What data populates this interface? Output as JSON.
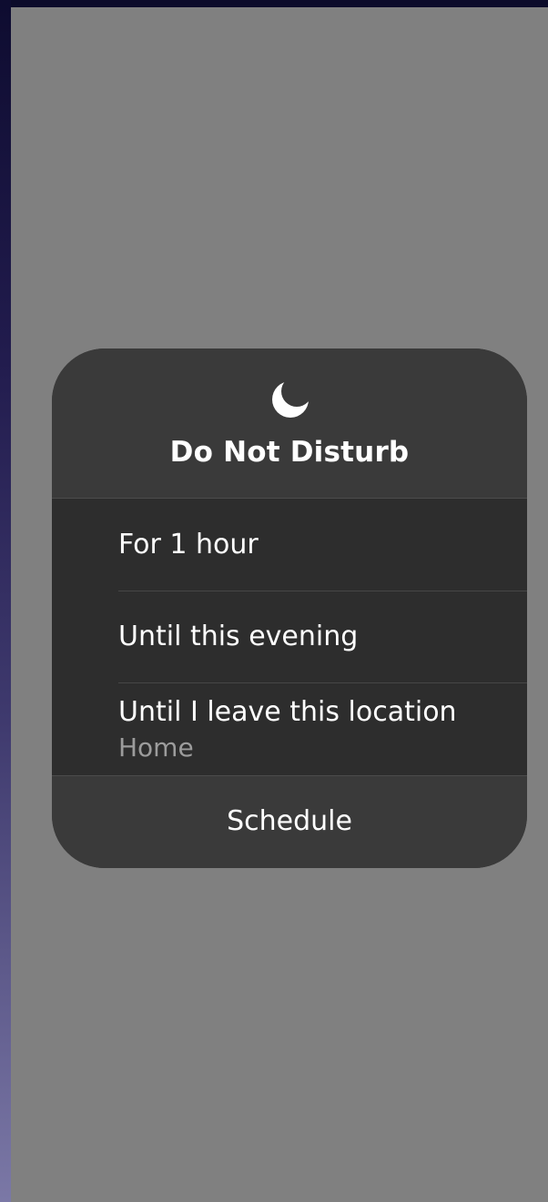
{
  "dnd": {
    "icon": "moon-icon",
    "title": "Do Not Disturb",
    "options": [
      {
        "label": "For 1 hour"
      },
      {
        "label": "Until this evening"
      },
      {
        "label": "Until I leave this location",
        "sublabel": "Home"
      }
    ],
    "schedule_label": "Schedule"
  },
  "colors": {
    "backdrop": "#808080",
    "card": "#383838",
    "options_bg": "#2d2d2d",
    "text": "#ffffff",
    "subtext": "#9c9c9c"
  }
}
